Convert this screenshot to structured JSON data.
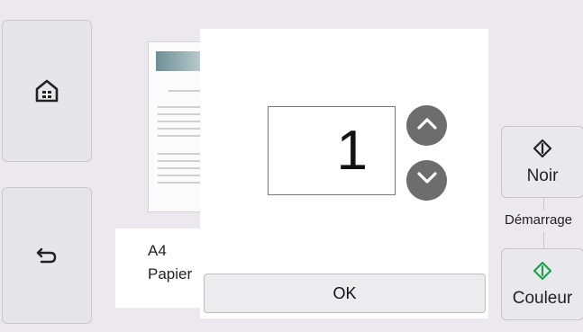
{
  "paper": {
    "size": "A4",
    "type": "Papier"
  },
  "dialog": {
    "copies": "1",
    "ok_label": "OK"
  },
  "start": {
    "label": "Démarrage",
    "black_label": "Noir",
    "color_label": "Couleur"
  },
  "icons": {
    "home": "home-icon",
    "back": "back-icon",
    "up": "chevron-up-icon",
    "down": "chevron-down-icon",
    "start_black": "start-diamond-icon",
    "start_color": "start-diamond-green-icon"
  },
  "colors": {
    "background": "#ebe9ee",
    "stepper": "#6d6d6d",
    "color_start": "#1aa34a",
    "black_start": "#222222"
  }
}
